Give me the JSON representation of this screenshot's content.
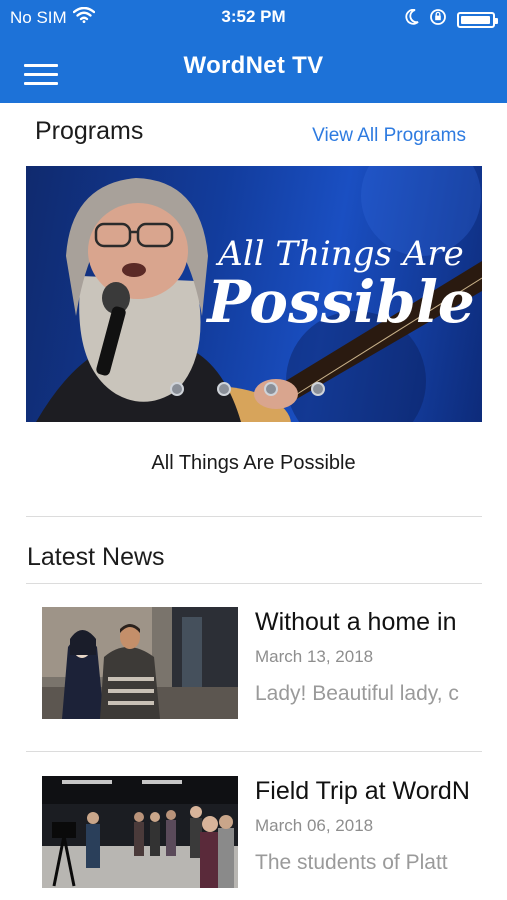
{
  "status_bar": {
    "carrier": "No SIM",
    "time": "3:52 PM",
    "battery_level": 0.95,
    "icons": [
      "wifi-icon",
      "moon-icon",
      "orientation-lock-icon",
      "battery-icon"
    ]
  },
  "app": {
    "title": "WordNet TV",
    "accent_color": "#1d72d8",
    "link_color": "#2e7be0"
  },
  "programs": {
    "heading": "Programs",
    "view_all_label": "View All Programs",
    "carousel": {
      "banner_line1": "All Things Are",
      "banner_line2": "Possible",
      "slide_count": 4,
      "caption": "All Things Are Possible"
    }
  },
  "news": {
    "heading": "Latest News",
    "items": [
      {
        "headline": "Without a home in",
        "date": "March 13, 2018",
        "snippet": "Lady! Beautiful lady, c"
      },
      {
        "headline": "Field Trip at WordN",
        "date": "March 06, 2018",
        "snippet": "The students of Platt"
      }
    ]
  }
}
